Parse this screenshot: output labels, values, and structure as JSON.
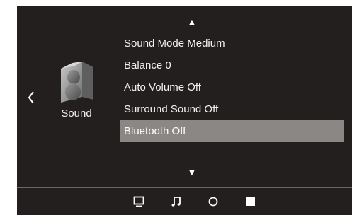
{
  "navigation": {
    "up_icon": "triangle-up-icon",
    "down_icon": "triangle-down-icon",
    "back_icon": "chevron-left-icon"
  },
  "category": {
    "label": "Sound",
    "icon": "speaker-icon"
  },
  "menu": {
    "items": [
      {
        "label": "Sound Mode Medium"
      },
      {
        "label": "Balance 0"
      },
      {
        "label": "Auto Volume Off"
      },
      {
        "label": "Surround Sound Off"
      },
      {
        "label": "Bluetooth Off",
        "selected": true
      }
    ]
  },
  "bottom_bar": {
    "icons": [
      "tv-icon",
      "music-note-icon",
      "circle-icon",
      "square-icon"
    ]
  },
  "colors": {
    "background": "#231f1e",
    "selection": "#8b8785",
    "text": "#f2f2f2"
  }
}
